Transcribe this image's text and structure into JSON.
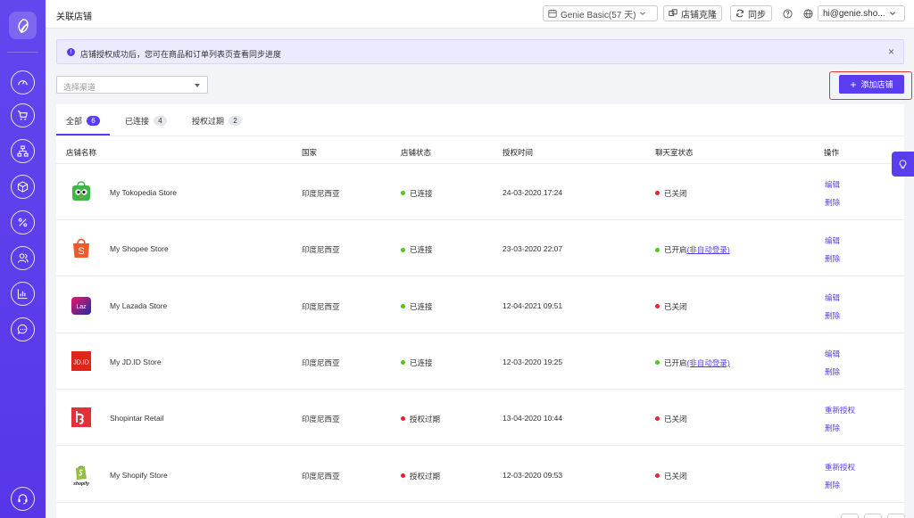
{
  "header": {
    "title": "关联店铺",
    "plan_label": "Genie Basic(57 天)",
    "clone_label": "店铺克隆",
    "sync_label": "同步",
    "user_email": "hi@genie.sho..."
  },
  "sidebar": {
    "items": [
      {
        "icon": "dashboard-icon"
      },
      {
        "icon": "cart-icon"
      },
      {
        "icon": "network-icon"
      },
      {
        "icon": "box-icon"
      },
      {
        "icon": "percent-icon"
      },
      {
        "icon": "users-icon"
      },
      {
        "icon": "bar-chart-icon"
      },
      {
        "icon": "chat-icon"
      }
    ],
    "bottom_icon": "support-icon"
  },
  "notice": {
    "text": "店铺授权成功后，您可在商品和订单列表页查看同步进度",
    "close": "×"
  },
  "filter": {
    "placeholder": "选择渠道",
    "add_label": "添加店铺"
  },
  "tabs": [
    {
      "label": "全部",
      "count": "6"
    },
    {
      "label": "已连接",
      "count": "4"
    },
    {
      "label": "授权过期",
      "count": "2"
    }
  ],
  "table": {
    "headers": [
      "店铺名称",
      "国家",
      "店铺状态",
      "授权时间",
      "聊天室状态",
      "操作"
    ],
    "rows": [
      {
        "name": "My Tokopedia Store",
        "logo": "tokopedia",
        "country": "印度尼西亚",
        "status": "已连接",
        "status_color": "#52c41a",
        "time": "24-03-2020 17:24",
        "chat": "已关闭",
        "chat_color": "#e8232f",
        "chat_link": "",
        "op1": "编辑",
        "op2": "删除"
      },
      {
        "name": "My Shopee Store",
        "logo": "shopee",
        "country": "印度尼西亚",
        "status": "已连接",
        "status_color": "#52c41a",
        "time": "23-03-2020 22:07",
        "chat": "已开启",
        "chat_color": "#52c41a",
        "chat_link": "(非自动登录)",
        "op1": "编辑",
        "op2": "删除"
      },
      {
        "name": "My Lazada Store",
        "logo": "lazada",
        "country": "印度尼西亚",
        "status": "已连接",
        "status_color": "#52c41a",
        "time": "12-04-2021 09:51",
        "chat": "已关闭",
        "chat_color": "#e8232f",
        "chat_link": "",
        "op1": "编辑",
        "op2": "删除"
      },
      {
        "name": "My JD.ID Store",
        "logo": "jdid",
        "country": "印度尼西亚",
        "status": "已连接",
        "status_color": "#52c41a",
        "time": "12-03-2020 19:25",
        "chat": "已开启",
        "chat_color": "#52c41a",
        "chat_link": "(非自动登录)",
        "op1": "编辑",
        "op2": "删除"
      },
      {
        "name": "Shopintar Retail",
        "logo": "shopintar",
        "country": "印度尼西亚",
        "status": "授权过期",
        "status_color": "#e8232f",
        "time": "13-04-2020 10:44",
        "chat": "已关闭",
        "chat_color": "#e8232f",
        "chat_link": "",
        "op1": "重新授权",
        "op2": "删除"
      },
      {
        "name": "My Shopify Store",
        "logo": "shopify",
        "country": "印度尼西亚",
        "status": "授权过期",
        "status_color": "#e8232f",
        "time": "12-03-2020 09:53",
        "chat": "已关闭",
        "chat_color": "#e8232f",
        "chat_link": "",
        "op1": "重新授权",
        "op2": "删除"
      }
    ]
  },
  "logo_texts": {
    "lazada": "Laz",
    "jdid": "JD.ID",
    "shopee": "S",
    "shopify": "shopify"
  },
  "colors": {
    "accent": "#5b3df0",
    "connected": "#52c41a",
    "expired": "#e8232f"
  }
}
